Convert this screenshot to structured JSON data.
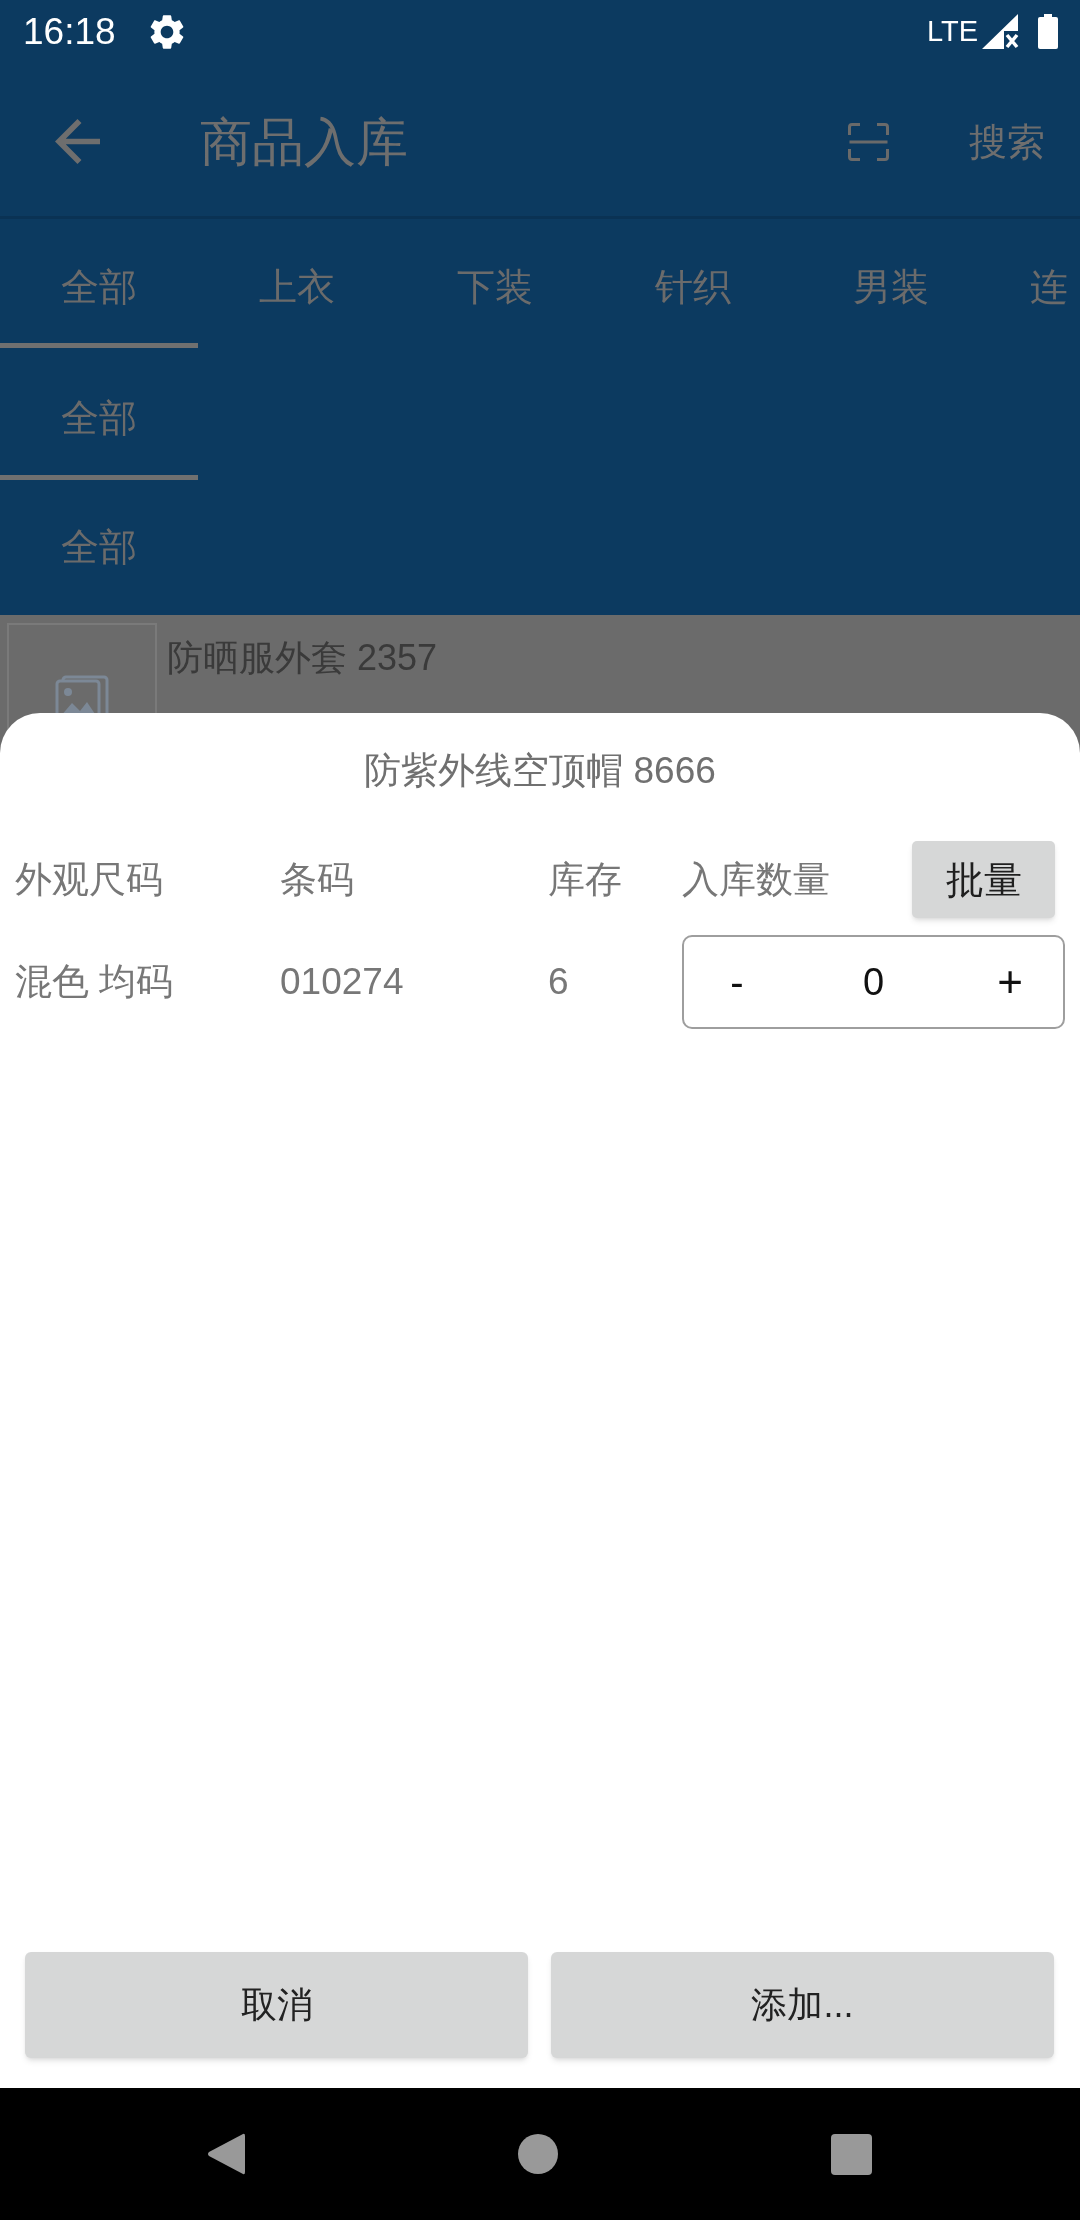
{
  "status_bar": {
    "time": "16:18",
    "network": "LTE"
  },
  "toolbar": {
    "title": "商品入库",
    "search": "搜索"
  },
  "category_tabs": [
    {
      "label": "全部",
      "selected": true
    },
    {
      "label": "上衣",
      "selected": false
    },
    {
      "label": "下装",
      "selected": false
    },
    {
      "label": "针织",
      "selected": false
    },
    {
      "label": "男装",
      "selected": false
    },
    {
      "label": "连",
      "selected": false
    }
  ],
  "filter_levels": [
    {
      "label": "全部",
      "selected": true
    },
    {
      "label": "全部",
      "selected": false
    }
  ],
  "products": [
    {
      "name": "防晒服外套 2357"
    }
  ],
  "dialog": {
    "title": "防紫外线空顶帽 8666",
    "columns": [
      "外观尺码",
      "条码",
      "库存",
      "入库数量"
    ],
    "batch_button": "批量",
    "rows": [
      {
        "spec": "混色 均码",
        "barcode": "010274",
        "stock": "6",
        "quantity": "0",
        "decrement": "-",
        "increment": "+"
      }
    ],
    "buttons": [
      "取消",
      "添加..."
    ]
  }
}
